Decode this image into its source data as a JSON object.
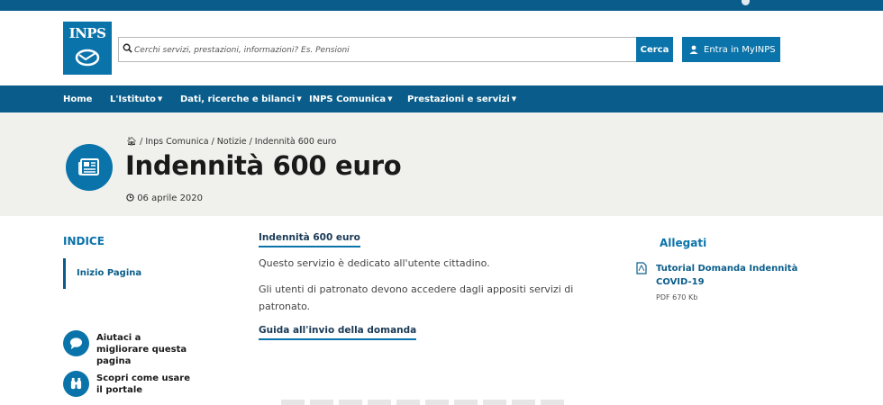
{
  "brand": {
    "logo_text": "INPS",
    "accent": "#0a73aa",
    "nav_bg": "#0a5d8b"
  },
  "search": {
    "placeholder": "Cerchi servizi, prestazioni, informazioni? Es. Pensioni",
    "button_label": "Cerca",
    "icon": "search-icon"
  },
  "login": {
    "label": "Entra in MyINPS",
    "icon": "user-icon"
  },
  "nav": {
    "items": [
      {
        "label": "Home",
        "dropdown": false
      },
      {
        "label": "L'Istituto",
        "dropdown": true
      },
      {
        "label": "Dati, ricerche e bilanci",
        "dropdown": true
      },
      {
        "label": "INPS Comunica",
        "dropdown": true
      },
      {
        "label": "Prestazioni e servizi",
        "dropdown": true
      }
    ]
  },
  "hero": {
    "breadcrumb": "/ Inps Comunica / Notizie / Indennità 600 euro",
    "title": "Indennità 600 euro",
    "date": "06 aprile 2020",
    "icon": "newspaper-icon"
  },
  "sidebar": {
    "index_title": "INDICE",
    "index_items": [
      {
        "label": "Inizio Pagina"
      }
    ],
    "help_links": [
      {
        "label": "Aiutaci a migliorare questa pagina",
        "icon": "chat-bubble-icon"
      },
      {
        "label": "Scopri come usare il portale",
        "icon": "binoculars-icon"
      }
    ]
  },
  "main": {
    "section_title": "Indennità 600 euro",
    "paragraph1": "Questo servizio è dedicato all'utente cittadino.",
    "paragraph2": "Gli utenti di patronato devono accedere dagli appositi servizi di patronato.",
    "guide_link": "Guida all'invio della domanda"
  },
  "attachments": {
    "title": "Allegati",
    "items": [
      {
        "name": "Tutorial Domanda Indennità COVID-19",
        "meta": "PDF 670 Kb",
        "icon": "pdf-file-icon"
      }
    ]
  }
}
